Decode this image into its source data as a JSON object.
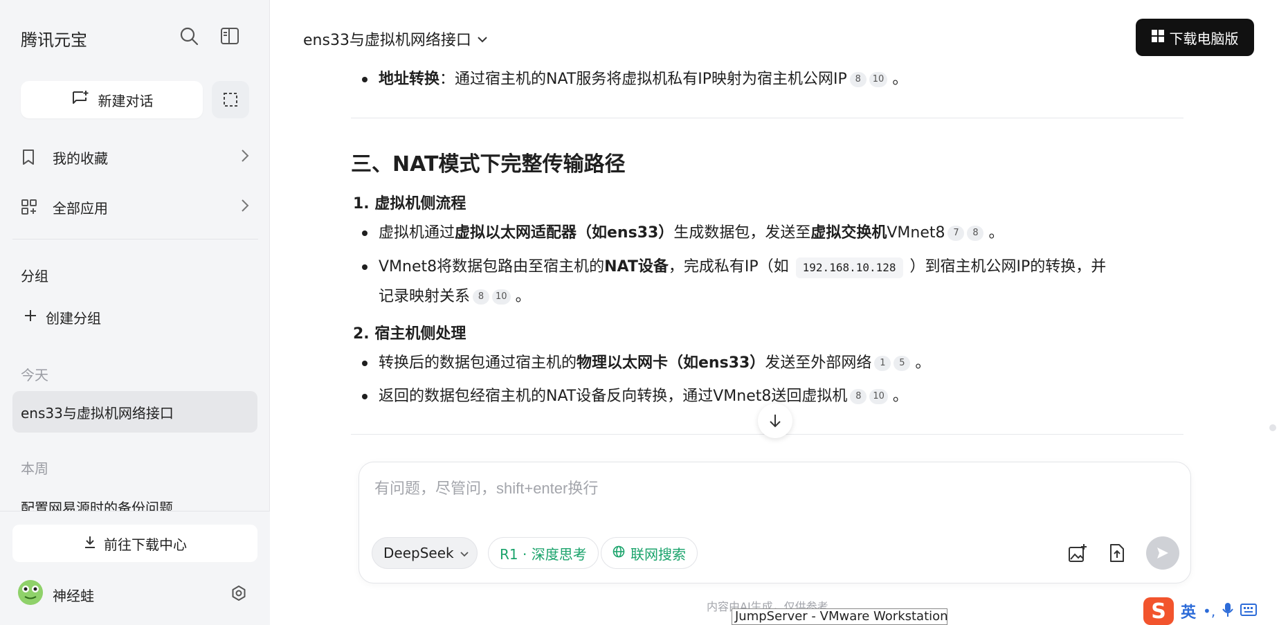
{
  "sidebar": {
    "brand": "腾讯元宝",
    "new_chat_label": "新建对话",
    "favorites_label": "我的收藏",
    "all_apps_label": "全部应用",
    "group_label": "分组",
    "create_group_label": "创建分组",
    "today_label": "今天",
    "active_chat": "ens33与虚拟机网络接口",
    "this_week_label": "本周",
    "week_chat": "配置网易源时的备份问题",
    "download_center_label": "前往下载中心",
    "username": "神经蛙"
  },
  "header": {
    "chat_title": "ens33与虚拟机网络接口",
    "download_pc_label": "下载电脑版"
  },
  "content": {
    "top_bullet": {
      "bold": "地址转换",
      "text": "：通过宿主机的NAT服务将虚拟机私有IP映射为宿主机公网IP",
      "cites": [
        "8",
        "10"
      ],
      "end": "。"
    },
    "section_heading": "三、NAT模式下完整传输路径",
    "sub1": "1. 虚拟机侧流程",
    "b1": {
      "t1": "虚拟机通过",
      "bold1": "虚拟以太网适配器（如ens33）",
      "t2": "生成数据包，发送至",
      "bold2": "虚拟交换机",
      "t3": "VMnet8",
      "cites": [
        "7",
        "8"
      ],
      "end": "。"
    },
    "b2": {
      "t1": "VMnet8将数据包路由至宿主机的",
      "bold1": "NAT设备",
      "t2": "，完成私有IP（如",
      "code": "192.168.10.128",
      "t3": "）到宿主机公网IP的转换，并",
      "line2": "记录映射关系",
      "cites": [
        "8",
        "10"
      ],
      "end": "。"
    },
    "sub2": "2. 宿主机侧处理",
    "b3": {
      "t1": "转换后的数据包通过宿主机的",
      "bold1": "物理以太网卡（如ens33）",
      "t2": "发送至外部网络",
      "cites": [
        "1",
        "5"
      ],
      "end": "。"
    },
    "b4": {
      "t1": "返回的数据包经宿主机的NAT设备反向转换，通过VMnet8送回虚拟机",
      "cites": [
        "8",
        "10"
      ],
      "end": "。"
    }
  },
  "input": {
    "placeholder": "有问题，尽管问，shift+enter换行",
    "model_label": "DeepSeek",
    "deep_think_label": "R1 · 深度思考",
    "web_search_label": "联网搜索"
  },
  "footer": {
    "disclaimer": "内容由AI生成，仅供参考",
    "taskbar_tip": "JumpServer - VMware Workstation",
    "ime_logo": "S",
    "ime_lang": "英",
    "ime_punct": "•,"
  },
  "colors": {
    "accent_green": "#1aa36b",
    "dark_button": "#111111",
    "sidebar_bg": "#f4f5f7"
  }
}
